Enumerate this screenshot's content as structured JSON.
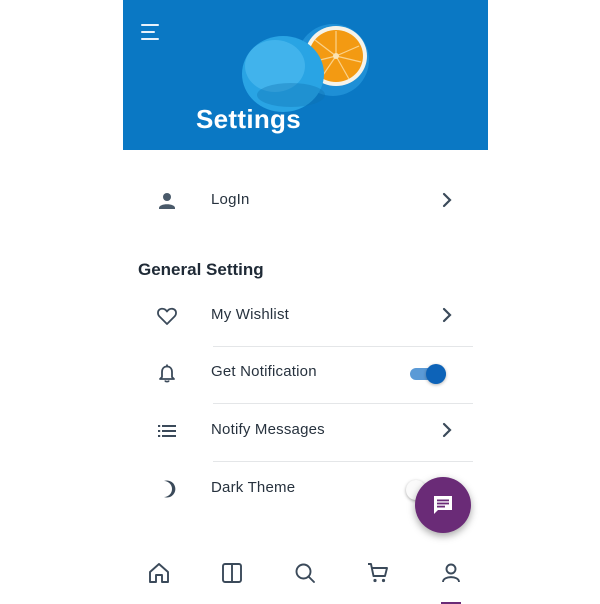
{
  "header": {
    "title": "Settings",
    "menu_icon": "menu-icon",
    "background_color": "#0a78c4"
  },
  "account": {
    "login": {
      "label": "LogIn",
      "icon": "person-icon"
    }
  },
  "general": {
    "section_title": "General Setting",
    "items": [
      {
        "label": "My Wishlist",
        "icon": "heart-icon",
        "control": "chevron"
      },
      {
        "label": "Get Notification",
        "icon": "bell-icon",
        "control": "toggle",
        "enabled": true
      },
      {
        "label": "Notify Messages",
        "icon": "list-icon",
        "control": "chevron"
      },
      {
        "label": "Dark Theme",
        "icon": "moon-icon",
        "control": "toggle",
        "enabled": false
      }
    ]
  },
  "fab": {
    "icon": "chat-message-icon",
    "color": "#6a2b77"
  },
  "bottom_nav": {
    "items": [
      {
        "icon": "home-icon"
      },
      {
        "icon": "book-icon"
      },
      {
        "icon": "search-icon"
      },
      {
        "icon": "cart-icon"
      },
      {
        "icon": "profile-icon",
        "active": true
      }
    ],
    "active_color": "#6a2b77"
  },
  "colors": {
    "toggle_on_track": "#5b9ad6",
    "toggle_on_thumb": "#0d63b8",
    "icon": "#3b4a5a"
  }
}
